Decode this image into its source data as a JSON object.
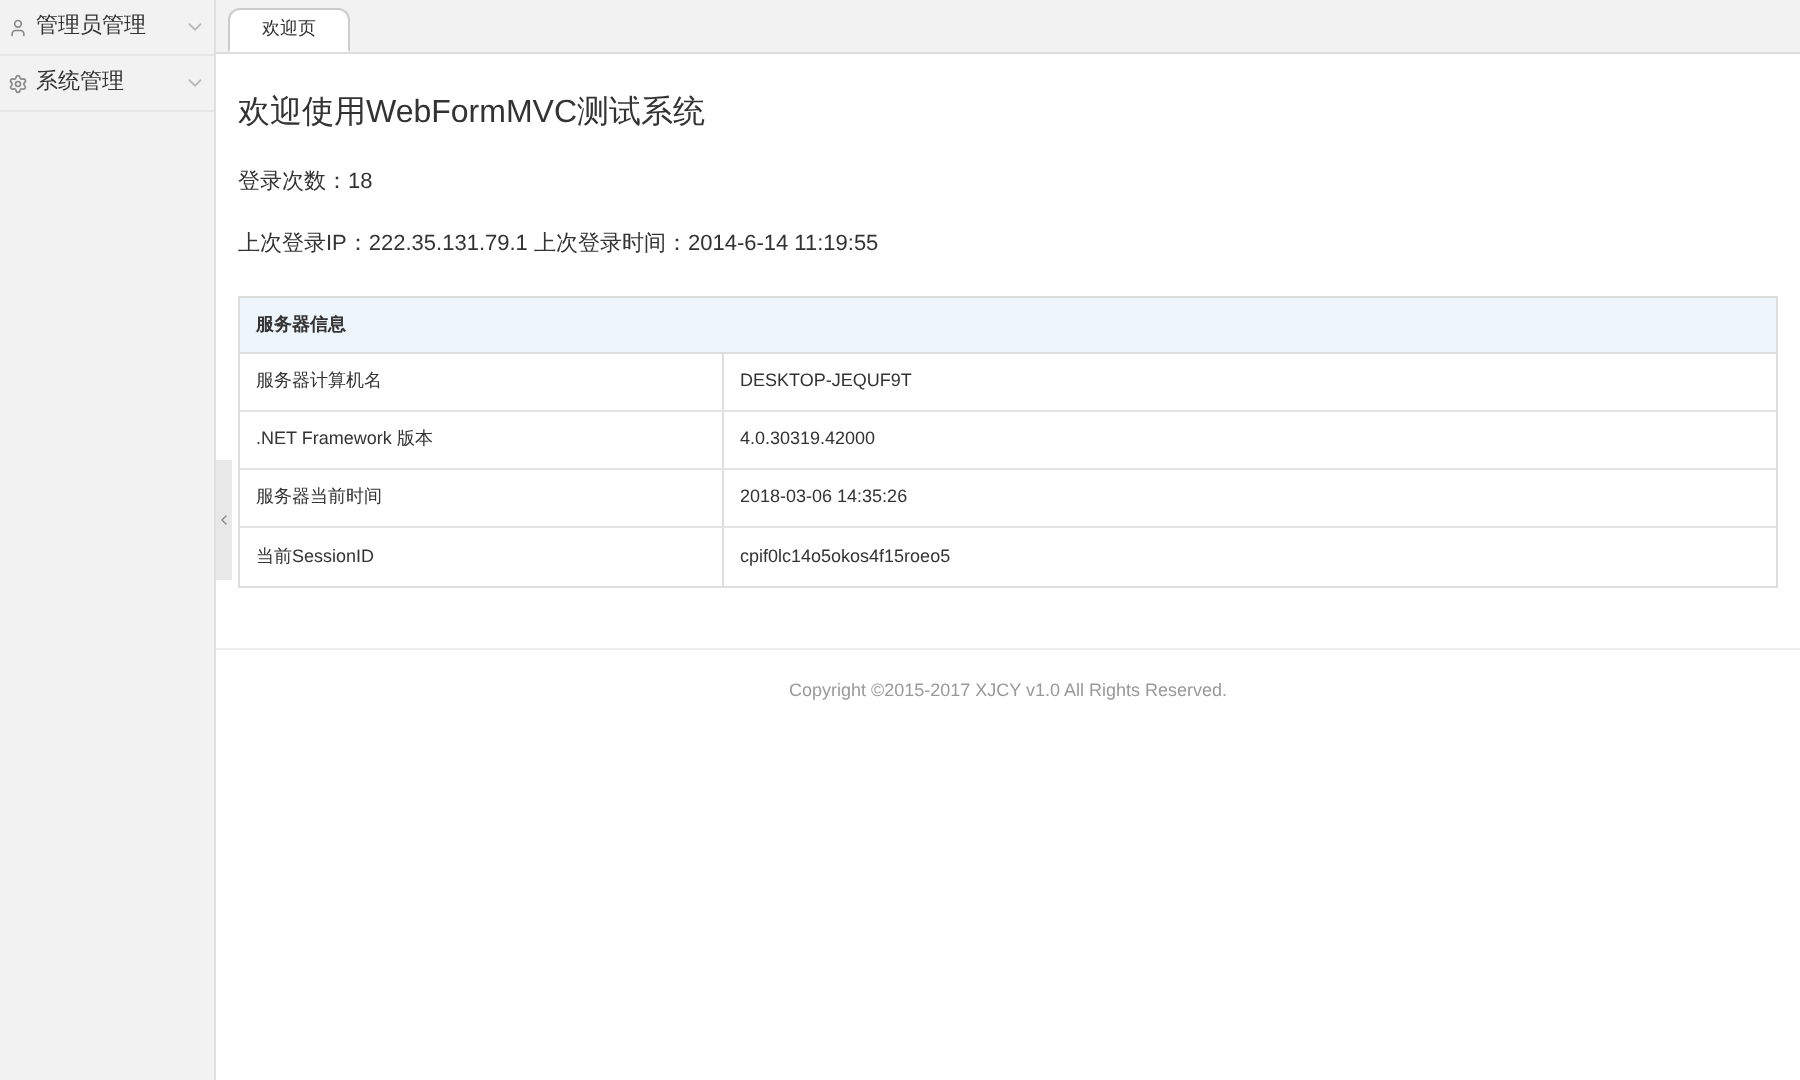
{
  "sidebar": {
    "items": [
      {
        "label": "管理员管理",
        "kind": "user",
        "expanded": false
      },
      {
        "label": "系统管理",
        "kind": "gear",
        "expanded": false
      }
    ]
  },
  "tabs": [
    {
      "label": "欢迎页",
      "selected": true
    }
  ],
  "welcome": {
    "title": "欢迎使用WebFormMVC测试系统",
    "login_count": "登录次数：18",
    "last_login": "上次登录IP：222.35.131.79.1 上次登录时间：2014-6-14 11:19:55"
  },
  "server_table": {
    "title": "服务器信息",
    "rows": [
      {
        "name": "服务器计算机名",
        "value": "DESKTOP-JEQUF9T"
      },
      {
        "name": ".NET Framework 版本",
        "value": "4.0.30319.42000"
      },
      {
        "name": "服务器当前时间",
        "value": "2018-03-06 14:35:26"
      },
      {
        "name": "当前SessionID",
        "value": "cpif0lc14o5okos4f15roeo5"
      }
    ]
  },
  "footer": "Copyright ©2015-2017 XJCY v1.0 All Rights Reserved."
}
